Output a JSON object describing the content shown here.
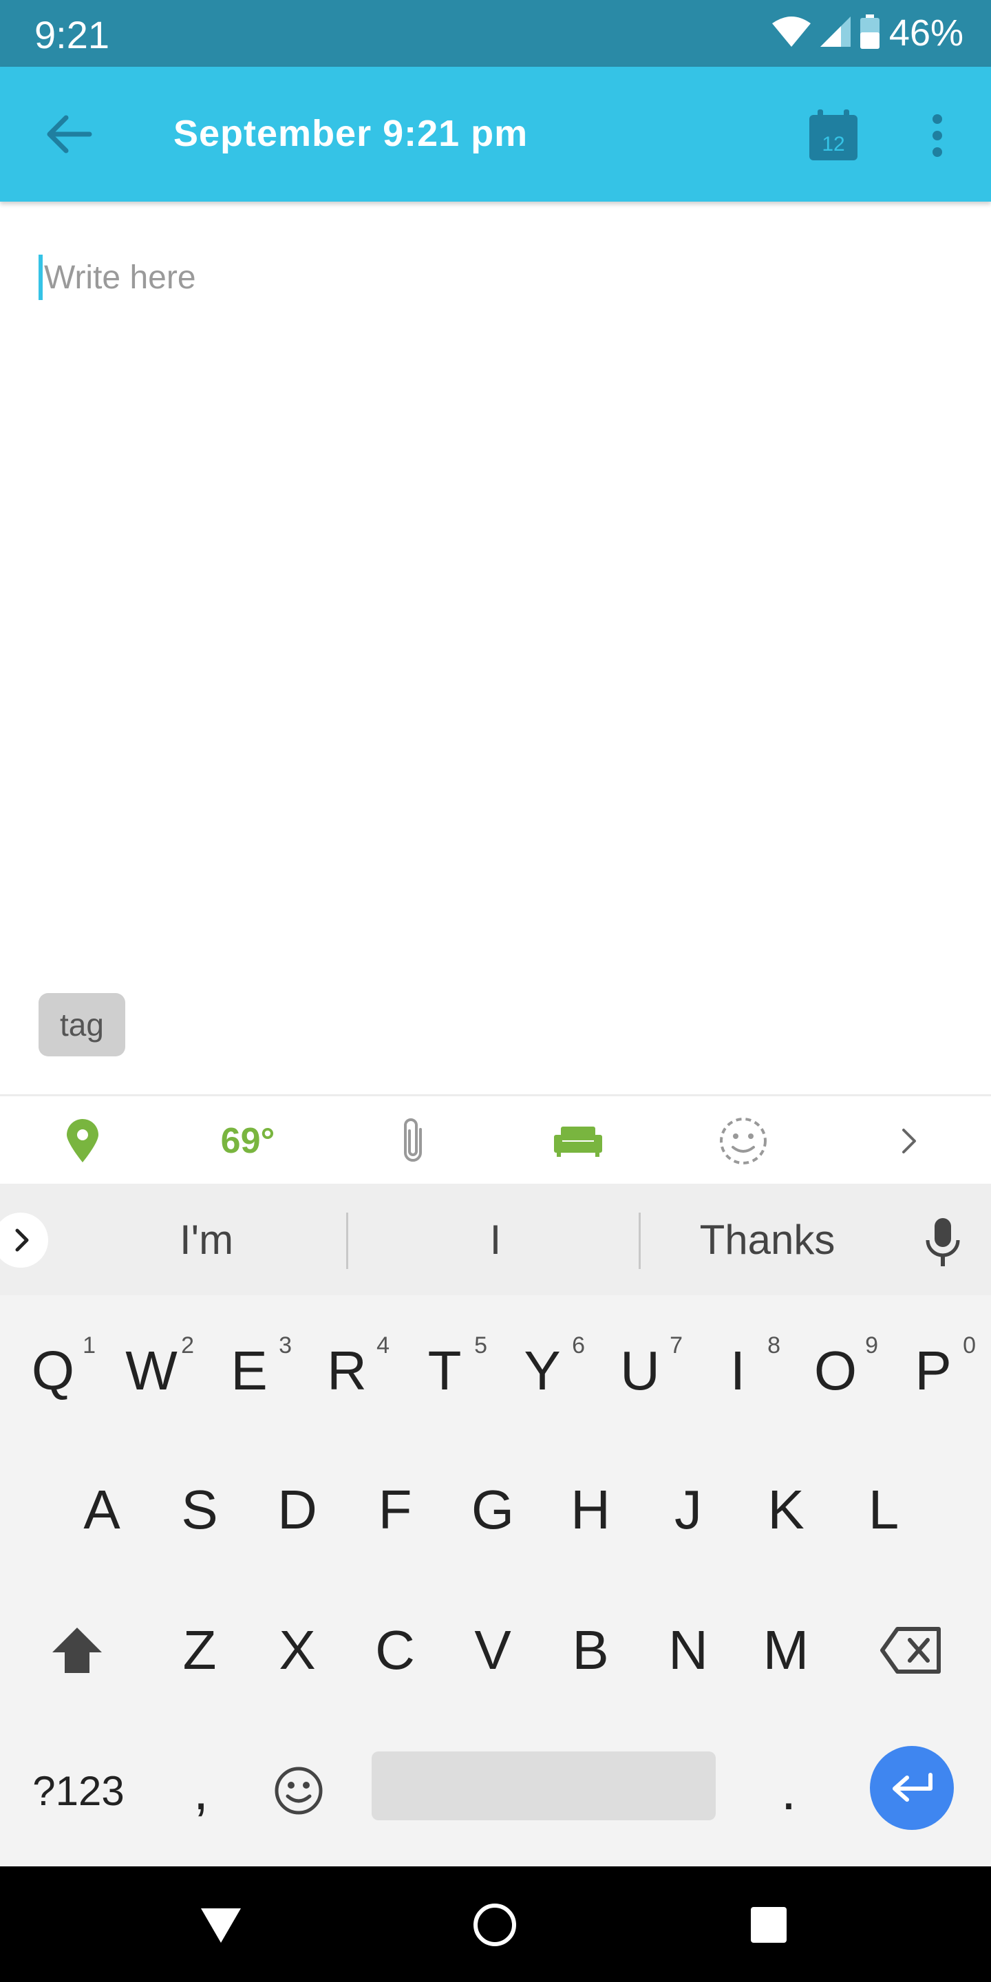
{
  "status_bar": {
    "time": "9:21",
    "battery": "46%"
  },
  "app_bar": {
    "title": "September 9:21 pm",
    "calendar_day": "12"
  },
  "editor": {
    "placeholder": "Write here"
  },
  "tag_chip": {
    "label": "tag"
  },
  "toolbar": {
    "temperature": "69°"
  },
  "suggestions": [
    "I'm",
    "I",
    "Thanks"
  ],
  "keyboard": {
    "row1": [
      {
        "key": "Q",
        "hint": "1"
      },
      {
        "key": "W",
        "hint": "2"
      },
      {
        "key": "E",
        "hint": "3"
      },
      {
        "key": "R",
        "hint": "4"
      },
      {
        "key": "T",
        "hint": "5"
      },
      {
        "key": "Y",
        "hint": "6"
      },
      {
        "key": "U",
        "hint": "7"
      },
      {
        "key": "I",
        "hint": "8"
      },
      {
        "key": "O",
        "hint": "9"
      },
      {
        "key": "P",
        "hint": "0"
      }
    ],
    "row2": [
      "A",
      "S",
      "D",
      "F",
      "G",
      "H",
      "J",
      "K",
      "L"
    ],
    "row3": [
      "Z",
      "X",
      "C",
      "V",
      "B",
      "N",
      "M"
    ],
    "bottom": {
      "symbols": "?123",
      "comma": ",",
      "period": "."
    }
  },
  "colors": {
    "status_bar": "#2a8aa6",
    "app_bar": "#35c3e6",
    "accent_green": "#79b53f",
    "enter_blue": "#3f86f0"
  }
}
